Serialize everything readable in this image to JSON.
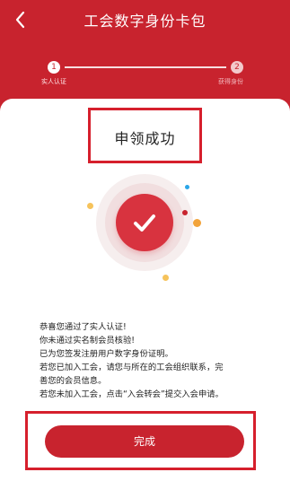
{
  "header": {
    "title": "工会数字身份卡包",
    "back_icon": "chevron-left-icon"
  },
  "steps": [
    {
      "number": "1",
      "label": "实人认证",
      "state": "done"
    },
    {
      "number": "2",
      "label": "获得身份",
      "state": "pending"
    }
  ],
  "result": {
    "title": "申领成功",
    "icon": "check-icon"
  },
  "message": {
    "lines": [
      "恭喜您通过了实人认证!",
      "你未通过实名制会员核验!",
      "已为您签发注册用户数字身份证明。",
      "若您已加入工会，请您与所在的工会组织联系，完",
      "善您的会员信息。",
      "若您未加入工会，点击“入会转会”提交入会申请。"
    ]
  },
  "actions": {
    "done_label": "完成"
  },
  "colors": {
    "primary": "#c8232e",
    "highlight": "#d61f2c"
  }
}
